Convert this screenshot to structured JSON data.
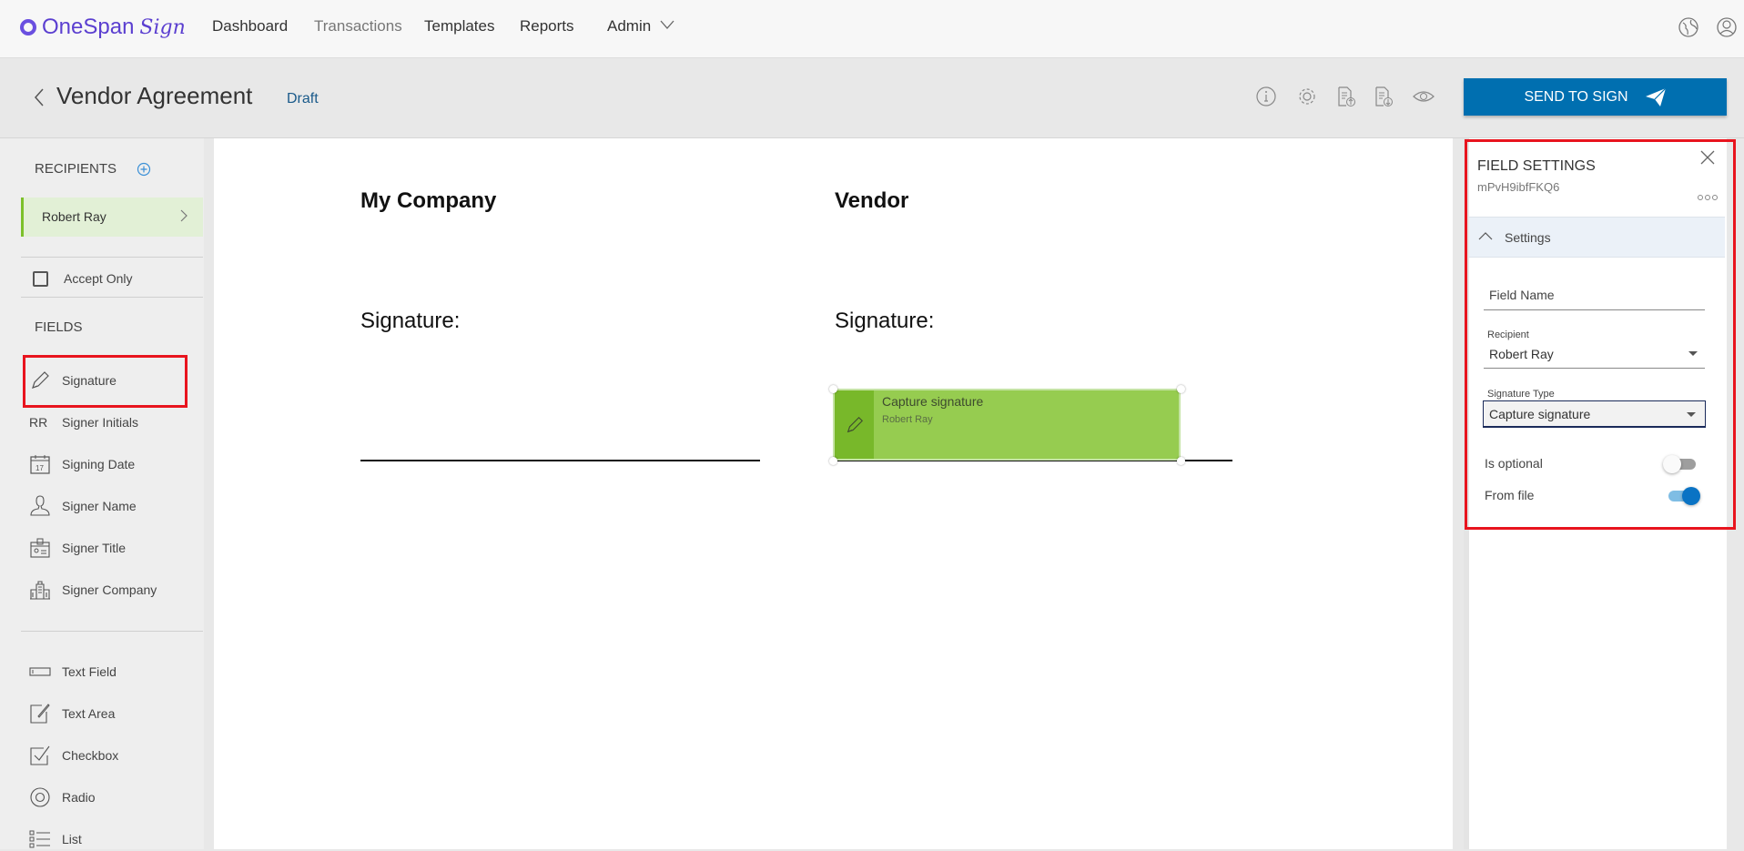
{
  "app": {
    "logo_text": "OneSpan",
    "logo_script": "Sign"
  },
  "nav": {
    "items": [
      "Dashboard",
      "Transactions",
      "Templates",
      "Reports",
      "Admin"
    ]
  },
  "header": {
    "title": "Vendor Agreement",
    "status": "Draft",
    "send_label": "SEND TO SIGN",
    "icons": [
      "info-icon",
      "settings-icon",
      "upload-document-icon",
      "download-document-icon",
      "preview-eye-icon"
    ]
  },
  "sidebar": {
    "recipients_label": "RECIPIENTS",
    "recipient": "Robert Ray",
    "accept_only": "Accept Only",
    "fields_label": "FIELDS",
    "initials_badge": "RR",
    "fields": [
      "Signature",
      "Signer Initials",
      "Signing Date",
      "Signer Name",
      "Signer Title",
      "Signer Company"
    ],
    "inputs": [
      "Text Field",
      "Text Area",
      "Checkbox",
      "Radio",
      "List"
    ]
  },
  "document": {
    "left_heading": "My Company",
    "right_heading": "Vendor",
    "signature_label": "Signature:",
    "sig_field": {
      "title": "Capture signature",
      "recipient": "Robert Ray"
    }
  },
  "panel": {
    "title": "FIELD SETTINGS",
    "field_id": "mPvH9ibfFKQ6",
    "section": "Settings",
    "field_name_placeholder": "Field Name",
    "recipient_label": "Recipient",
    "recipient_value": "Robert Ray",
    "sig_type_label": "Signature Type",
    "sig_type_value": "Capture signature",
    "is_optional_label": "Is optional",
    "is_optional": false,
    "from_file_label": "From file",
    "from_file": true
  },
  "colors": {
    "accent": "#006fb0",
    "highlight": "#e8141e",
    "field_green": "#96cc50"
  }
}
